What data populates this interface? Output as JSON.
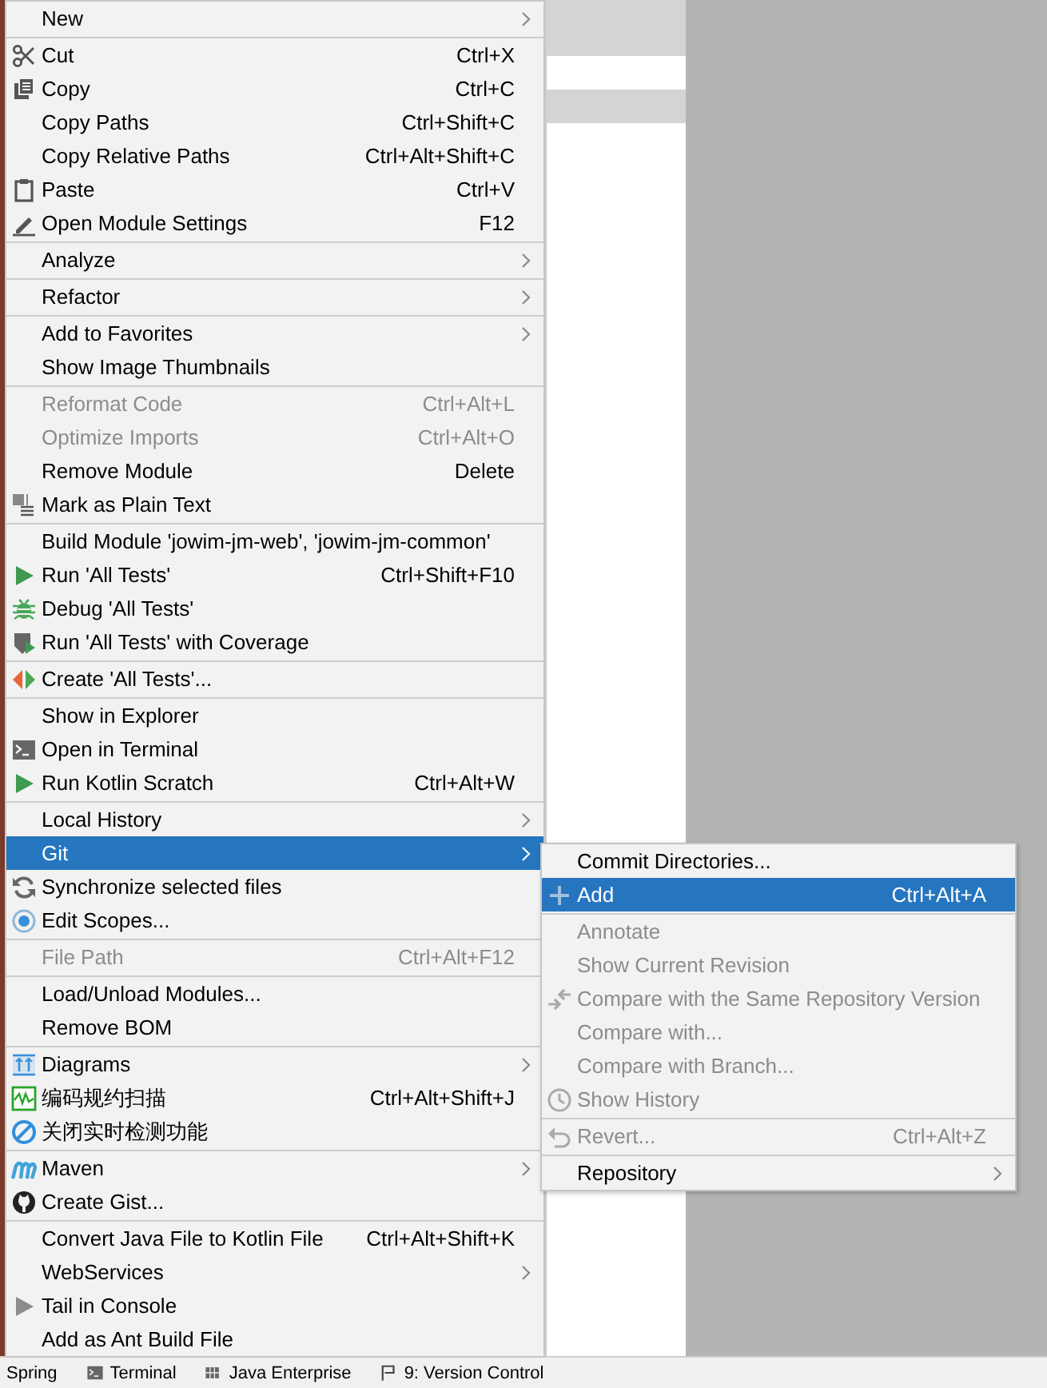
{
  "context_menu": {
    "groups": [
      {
        "items": [
          {
            "label": "New",
            "has_submenu": true,
            "disabled": false,
            "selected": false
          }
        ]
      },
      {
        "items": [
          {
            "label": "Cut",
            "shortcut": "Ctrl+X",
            "has_submenu": false,
            "disabled": false,
            "selected": false
          },
          {
            "label": "Copy",
            "shortcut": "Ctrl+C",
            "has_submenu": false,
            "disabled": false,
            "selected": false
          },
          {
            "label": "Copy Paths",
            "shortcut": "Ctrl+Shift+C",
            "has_submenu": false,
            "disabled": false,
            "selected": false
          },
          {
            "label": "Copy Relative Paths",
            "shortcut": "Ctrl+Alt+Shift+C",
            "has_submenu": false,
            "disabled": false,
            "selected": false
          },
          {
            "label": "Paste",
            "shortcut": "Ctrl+V",
            "has_submenu": false,
            "disabled": false,
            "selected": false
          },
          {
            "label": "Open Module Settings",
            "shortcut": "F12",
            "has_submenu": false,
            "disabled": false,
            "selected": false
          }
        ]
      },
      {
        "items": [
          {
            "label": "Analyze",
            "has_submenu": true,
            "disabled": false,
            "selected": false
          }
        ]
      },
      {
        "items": [
          {
            "label": "Refactor",
            "has_submenu": true,
            "disabled": false,
            "selected": false
          }
        ]
      },
      {
        "items": [
          {
            "label": "Add to Favorites",
            "has_submenu": true,
            "disabled": false,
            "selected": false
          },
          {
            "label": "Show Image Thumbnails",
            "has_submenu": false,
            "disabled": false,
            "selected": false
          }
        ]
      },
      {
        "items": [
          {
            "label": "Reformat Code",
            "shortcut": "Ctrl+Alt+L",
            "has_submenu": false,
            "disabled": true,
            "selected": false
          },
          {
            "label": "Optimize Imports",
            "shortcut": "Ctrl+Alt+O",
            "has_submenu": false,
            "disabled": true,
            "selected": false
          },
          {
            "label": "Remove Module",
            "shortcut": "Delete",
            "has_submenu": false,
            "disabled": false,
            "selected": false
          },
          {
            "label": "Mark as Plain Text",
            "has_submenu": false,
            "disabled": false,
            "selected": false
          }
        ]
      },
      {
        "items": [
          {
            "label": "Build Module 'jowim-jm-web', 'jowim-jm-common'",
            "has_submenu": false,
            "disabled": false,
            "selected": false
          },
          {
            "label": "Run 'All Tests'",
            "shortcut": "Ctrl+Shift+F10",
            "has_submenu": false,
            "disabled": false,
            "selected": false
          },
          {
            "label": "Debug 'All Tests'",
            "has_submenu": false,
            "disabled": false,
            "selected": false
          },
          {
            "label": "Run 'All Tests' with Coverage",
            "has_submenu": false,
            "disabled": false,
            "selected": false
          }
        ]
      },
      {
        "items": [
          {
            "label": "Create 'All Tests'...",
            "has_submenu": false,
            "disabled": false,
            "selected": false
          }
        ]
      },
      {
        "items": [
          {
            "label": "Show in Explorer",
            "has_submenu": false,
            "disabled": false,
            "selected": false
          },
          {
            "label": "Open in Terminal",
            "has_submenu": false,
            "disabled": false,
            "selected": false
          },
          {
            "label": "Run Kotlin Scratch",
            "shortcut": "Ctrl+Alt+W",
            "has_submenu": false,
            "disabled": false,
            "selected": false
          }
        ]
      },
      {
        "items": [
          {
            "label": "Local History",
            "has_submenu": true,
            "disabled": false,
            "selected": false
          },
          {
            "label": "Git",
            "has_submenu": true,
            "disabled": false,
            "selected": true
          },
          {
            "label": "Synchronize selected files",
            "has_submenu": false,
            "disabled": false,
            "selected": false
          },
          {
            "label": "Edit Scopes...",
            "has_submenu": false,
            "disabled": false,
            "selected": false
          }
        ]
      },
      {
        "items": [
          {
            "label": "File Path",
            "shortcut": "Ctrl+Alt+F12",
            "has_submenu": false,
            "disabled": true,
            "selected": false
          }
        ]
      },
      {
        "items": [
          {
            "label": "Load/Unload Modules...",
            "has_submenu": false,
            "disabled": false,
            "selected": false
          },
          {
            "label": "Remove BOM",
            "has_submenu": false,
            "disabled": false,
            "selected": false
          }
        ]
      },
      {
        "items": [
          {
            "label": "Diagrams",
            "has_submenu": true,
            "disabled": false,
            "selected": false
          },
          {
            "label": "编码规约扫描",
            "shortcut": "Ctrl+Alt+Shift+J",
            "has_submenu": false,
            "disabled": false,
            "selected": false
          },
          {
            "label": "关闭实时检测功能",
            "has_submenu": false,
            "disabled": false,
            "selected": false
          }
        ]
      },
      {
        "items": [
          {
            "label": "Maven",
            "has_submenu": true,
            "disabled": false,
            "selected": false
          },
          {
            "label": "Create Gist...",
            "has_submenu": false,
            "disabled": false,
            "selected": false
          }
        ]
      },
      {
        "items": [
          {
            "label": "Convert Java File to Kotlin File",
            "shortcut": "Ctrl+Alt+Shift+K",
            "has_submenu": false,
            "disabled": false,
            "selected": false
          },
          {
            "label": "WebServices",
            "has_submenu": true,
            "disabled": false,
            "selected": false
          },
          {
            "label": "Tail in Console",
            "has_submenu": false,
            "disabled": false,
            "selected": false
          },
          {
            "label": "Add as Ant Build File",
            "has_submenu": false,
            "disabled": false,
            "selected": false
          }
        ]
      }
    ]
  },
  "git_submenu": {
    "groups": [
      {
        "items": [
          {
            "label": "Commit Directories...",
            "has_submenu": false,
            "disabled": false,
            "selected": false
          },
          {
            "label": "Add",
            "shortcut": "Ctrl+Alt+A",
            "has_submenu": false,
            "disabled": false,
            "selected": true
          }
        ]
      },
      {
        "items": [
          {
            "label": "Annotate",
            "has_submenu": false,
            "disabled": true,
            "selected": false
          },
          {
            "label": "Show Current Revision",
            "has_submenu": false,
            "disabled": true,
            "selected": false
          },
          {
            "label": "Compare with the Same Repository Version",
            "has_submenu": false,
            "disabled": true,
            "selected": false
          },
          {
            "label": "Compare with...",
            "has_submenu": false,
            "disabled": true,
            "selected": false
          },
          {
            "label": "Compare with Branch...",
            "has_submenu": false,
            "disabled": true,
            "selected": false
          },
          {
            "label": "Show History",
            "has_submenu": false,
            "disabled": true,
            "selected": false
          }
        ]
      },
      {
        "items": [
          {
            "label": "Revert...",
            "shortcut": "Ctrl+Alt+Z",
            "has_submenu": false,
            "disabled": true,
            "selected": false
          }
        ]
      },
      {
        "items": [
          {
            "label": "Repository",
            "has_submenu": true,
            "disabled": false,
            "selected": false
          }
        ]
      }
    ]
  },
  "tool_window_bar": [
    {
      "label": "Spring"
    },
    {
      "label": "Terminal"
    },
    {
      "label": "Java Enterprise"
    },
    {
      "label": "9: Version Control"
    }
  ]
}
